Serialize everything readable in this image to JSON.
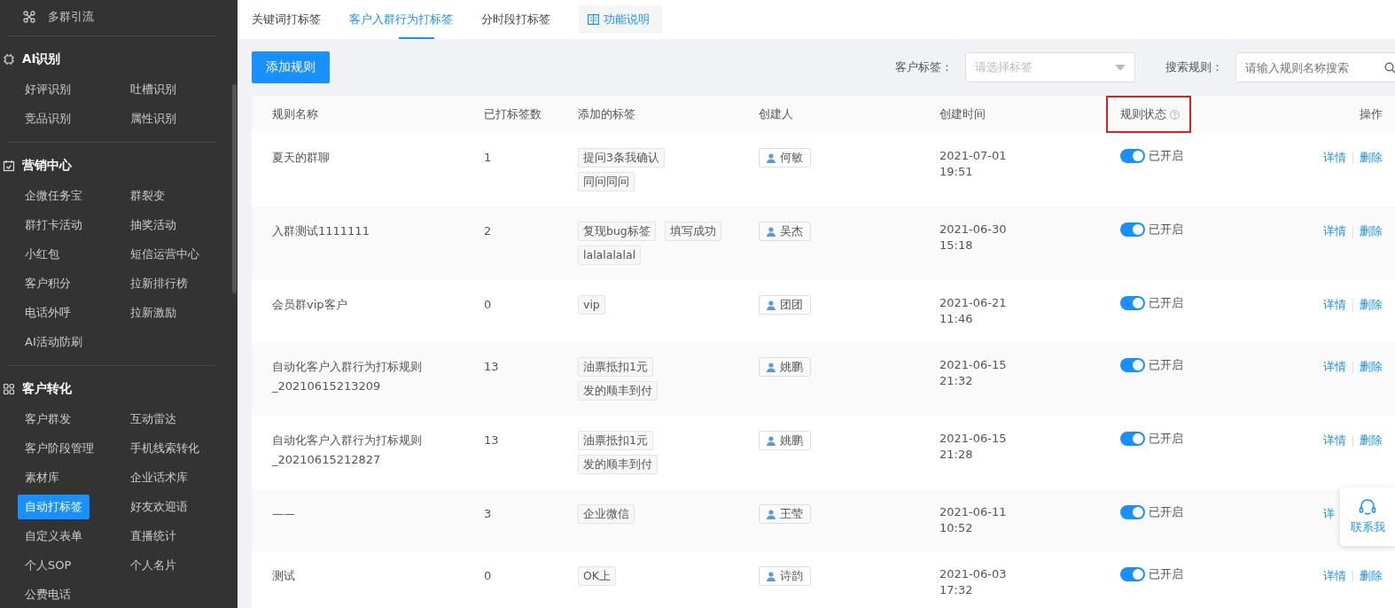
{
  "sidebar": {
    "top_item": {
      "label": "多群引流"
    },
    "sections": [
      {
        "title": "AI识别",
        "items": [
          {
            "label": "好评识别",
            "selected": false
          },
          {
            "label": "吐槽识别",
            "selected": false
          },
          {
            "label": "竞品识别",
            "selected": false
          },
          {
            "label": "属性识别",
            "selected": false
          }
        ]
      },
      {
        "title": "营销中心",
        "items": [
          {
            "label": "企微任务宝",
            "selected": false
          },
          {
            "label": "群裂变",
            "selected": false
          },
          {
            "label": "群打卡活动",
            "selected": false
          },
          {
            "label": "抽奖活动",
            "selected": false
          },
          {
            "label": "小红包",
            "selected": false
          },
          {
            "label": "短信运营中心",
            "selected": false
          },
          {
            "label": "客户积分",
            "selected": false
          },
          {
            "label": "拉新排行榜",
            "selected": false
          },
          {
            "label": "电话外呼",
            "selected": false
          },
          {
            "label": "拉新激励",
            "selected": false
          },
          {
            "label": "AI活动防刷",
            "selected": false
          }
        ]
      },
      {
        "title": "客户转化",
        "items": [
          {
            "label": "客户群发",
            "selected": false
          },
          {
            "label": "互动雷达",
            "selected": false
          },
          {
            "label": "客户阶段管理",
            "selected": false
          },
          {
            "label": "手机线索转化",
            "selected": false
          },
          {
            "label": "素材库",
            "selected": false
          },
          {
            "label": "企业话术库",
            "selected": false
          },
          {
            "label": "自动打标签",
            "selected": true
          },
          {
            "label": "好友欢迎语",
            "selected": false
          },
          {
            "label": "自定义表单",
            "selected": false
          },
          {
            "label": "直播统计",
            "selected": false
          },
          {
            "label": "个人SOP",
            "selected": false
          },
          {
            "label": "个人名片",
            "selected": false
          },
          {
            "label": "公费电话",
            "selected": false
          }
        ]
      }
    ]
  },
  "tabs": [
    {
      "label": "关键词打标签",
      "selected": false
    },
    {
      "label": "客户入群行为打标签",
      "selected": true
    },
    {
      "label": "分时段打标签",
      "selected": false
    }
  ],
  "help_link": {
    "label": "功能说明"
  },
  "toolbar": {
    "add_button": "添加规则",
    "tag_filter": {
      "label": "客户标签：",
      "placeholder": "请选择标签"
    },
    "search": {
      "label": "搜索规则：",
      "placeholder": "请输入规则名称搜索"
    }
  },
  "table": {
    "columns": [
      {
        "label": "规则名称",
        "highlighted": false
      },
      {
        "label": "已打标签数",
        "highlighted": false
      },
      {
        "label": "添加的标签",
        "highlighted": false
      },
      {
        "label": "创建人",
        "highlighted": false
      },
      {
        "label": "创建时间",
        "highlighted": false
      },
      {
        "label": "规则状态",
        "highlighted": true
      },
      {
        "label": "操作",
        "highlighted": false
      }
    ],
    "rows": [
      {
        "name": "夏天的群聊",
        "count": "1",
        "tags": [
          "提问3条我确认",
          "同问同问"
        ],
        "creator": "何敏",
        "created": "2021-07-01 19:51",
        "status": {
          "on": true,
          "label": "已开启"
        },
        "actions": [
          "详情",
          "删除"
        ]
      },
      {
        "name": "入群测试1111111",
        "count": "2",
        "tags": [
          "复现bug标签",
          "填写成功",
          "lalalalalal"
        ],
        "creator": "吴杰",
        "created": "2021-06-30 15:18",
        "status": {
          "on": true,
          "label": "已开启"
        },
        "actions": [
          "详情",
          "删除"
        ]
      },
      {
        "name": "会员群vip客户",
        "count": "0",
        "tags": [
          "vip"
        ],
        "creator": "团团",
        "created": "2021-06-21 11:46",
        "status": {
          "on": true,
          "label": "已开启"
        },
        "actions": [
          "详情",
          "删除"
        ]
      },
      {
        "name": "自动化客户入群行为打标规则_20210615213209",
        "count": "13",
        "tags": [
          "油票抵扣1元",
          "发的顺丰到付"
        ],
        "creator": "姚鹏",
        "created": "2021-06-15 21:32",
        "status": {
          "on": true,
          "label": "已开启"
        },
        "actions": [
          "详情",
          "删除"
        ]
      },
      {
        "name": "自动化客户入群行为打标规则_20210615212827",
        "count": "13",
        "tags": [
          "油票抵扣1元",
          "发的顺丰到付"
        ],
        "creator": "姚鹏",
        "created": "2021-06-15 21:28",
        "status": {
          "on": true,
          "label": "已开启"
        },
        "actions": [
          "详情",
          "删除"
        ]
      },
      {
        "name": "——",
        "count": "3",
        "tags": [
          "企业微信"
        ],
        "creator": "王莹",
        "created": "2021-06-11 10:52",
        "status": {
          "on": true,
          "label": "已开启"
        },
        "actions": [
          "详"
        ]
      },
      {
        "name": "测试",
        "count": "0",
        "tags": [
          "OK上"
        ],
        "creator": "诗韵",
        "created": "2021-06-03 17:32",
        "status": {
          "on": true,
          "label": "已开启"
        },
        "actions": [
          "详情",
          "删除"
        ]
      }
    ]
  },
  "contact_widget": {
    "label": "联系我"
  }
}
